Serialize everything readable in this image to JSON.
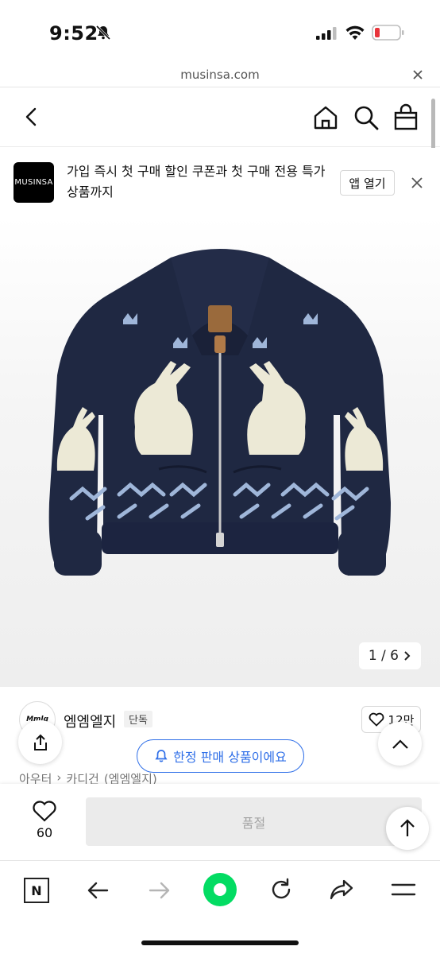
{
  "status_bar": {
    "time": "9:52"
  },
  "browser": {
    "url": "musinsa.com"
  },
  "promo_banner": {
    "logo_text": "MUSINSA",
    "message": "가입 즉시 첫 구매 할인 쿠폰과 첫 구매 전용 특가 상품까지",
    "open_app_label": "앱 열기"
  },
  "gallery": {
    "counter": "1 / 6"
  },
  "product": {
    "brand_logo_text": "Mmlg",
    "brand_name": "엠엠엘지",
    "exclusive_badge": "단독",
    "likes": "12만",
    "limited_notice": "한정 판매 상품이에요",
    "breadcrumb": [
      "아우터",
      "카디건",
      "(엠엠엘지)"
    ]
  },
  "purchase_bar": {
    "wish_count": "60",
    "soldout_label": "품절"
  },
  "toolbar": {
    "n_label": "N"
  },
  "colors": {
    "accent_blue": "#2f6fe8",
    "naver_green": "#03dc63",
    "navy": "#1f2842"
  }
}
